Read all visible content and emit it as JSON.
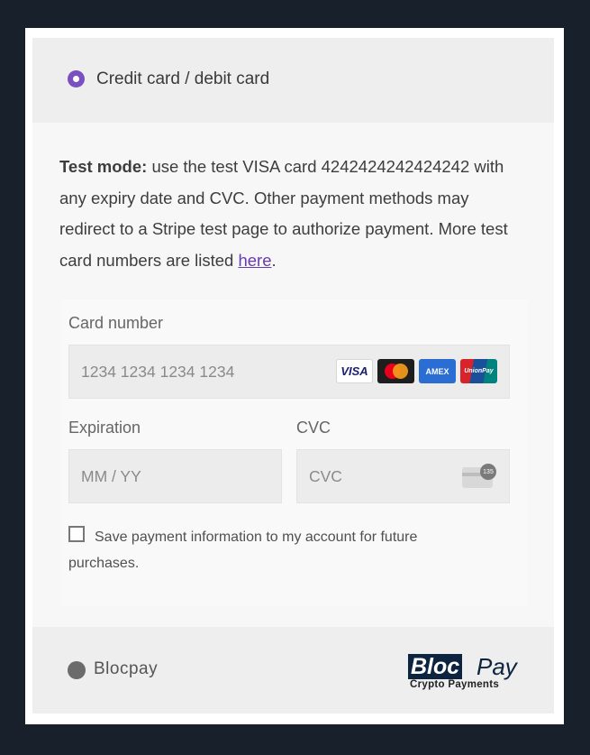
{
  "credit_card_option": {
    "label": "Credit card / debit card",
    "selected": true
  },
  "test_notice": {
    "bold_prefix": "Test mode:",
    "text": " use the test VISA card 4242424242424242 with any expiry date and CVC. Other payment methods may redirect to a Stripe test page to authorize payment. More test card numbers are listed ",
    "link_text": "here",
    "suffix": "."
  },
  "card_form": {
    "card_number_label": "Card number",
    "card_number_placeholder": "1234 1234 1234 1234",
    "brands": [
      {
        "name": "visa-icon",
        "label": "VISA"
      },
      {
        "name": "mastercard-icon",
        "label": ""
      },
      {
        "name": "amex-icon",
        "label": "AMEX"
      },
      {
        "name": "unionpay-icon",
        "label": "UnionPay"
      }
    ],
    "expiration_label": "Expiration",
    "expiration_placeholder": "MM / YY",
    "cvc_label": "CVC",
    "cvc_placeholder": "CVC",
    "cvc_icon_badge": "135",
    "save_label": "Save payment information to my account for future purchases.",
    "save_checked": false
  },
  "blocpay_option": {
    "label": "Blocpay",
    "selected": false,
    "logo_bloc": "Bloc",
    "logo_pay": "Pay",
    "logo_sub": "Crypto Payments"
  },
  "colors": {
    "background": "#17202b",
    "accent_purple": "#7a50c0",
    "link": "#6a3ab0",
    "logo_navy": "#0d2440"
  }
}
